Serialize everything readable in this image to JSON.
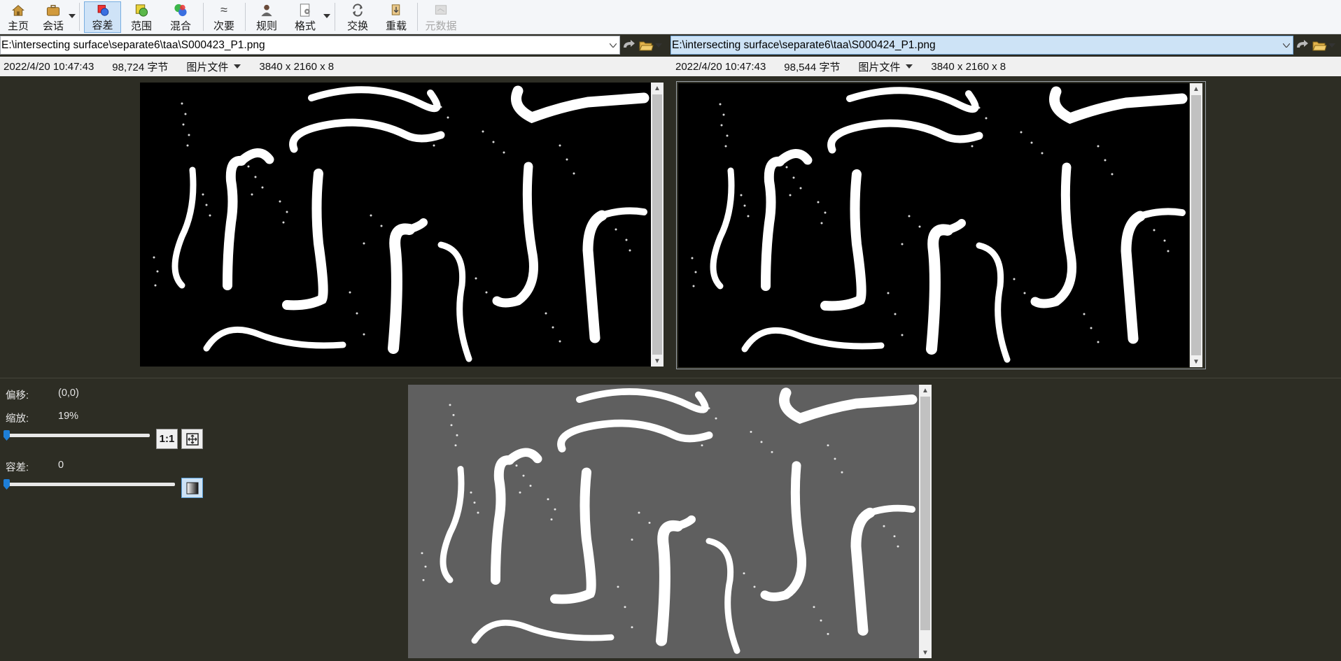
{
  "toolbar": {
    "items": [
      {
        "label": "主页",
        "icon": "home-icon"
      },
      {
        "label": "会话",
        "icon": "briefcase-icon"
      },
      {
        "label": "容差",
        "icon": "tolerance-icon"
      },
      {
        "label": "范围",
        "icon": "range-icon"
      },
      {
        "label": "混合",
        "icon": "blend-icon"
      },
      {
        "label": "次要",
        "icon": "approx-icon"
      },
      {
        "label": "规则",
        "icon": "rules-icon"
      },
      {
        "label": "格式",
        "icon": "format-icon"
      },
      {
        "label": "交换",
        "icon": "swap-icon"
      },
      {
        "label": "重载",
        "icon": "reload-icon"
      },
      {
        "label": "元数据",
        "icon": "metadata-icon"
      }
    ]
  },
  "left": {
    "path": "E:\\intersecting surface\\separate6\\taa\\S000423_P1.png",
    "date": "2022/4/20 10:47:43",
    "size": "98,724 字节",
    "filetype": "图片文件",
    "dims": "3840 x 2160 x 8"
  },
  "right": {
    "path": "E:\\intersecting surface\\separate6\\taa\\S000424_P1.png",
    "date": "2022/4/20 10:47:43",
    "size": "98,544 字节",
    "filetype": "图片文件",
    "dims": "3840 x 2160 x 8"
  },
  "controls": {
    "offset_label": "偏移:",
    "offset_value": "(0,0)",
    "zoom_label": "缩放:",
    "zoom_value": "19%",
    "one_to_one": "1:1",
    "tolerance_label": "容差:",
    "tolerance_value": "0",
    "zoom_slider_fraction": 0.0,
    "tolerance_slider_fraction": 0.0
  },
  "colors": {
    "accent": "#1e7fd8",
    "background": "#2d2d24",
    "diff_background": "#5f5f5f"
  }
}
